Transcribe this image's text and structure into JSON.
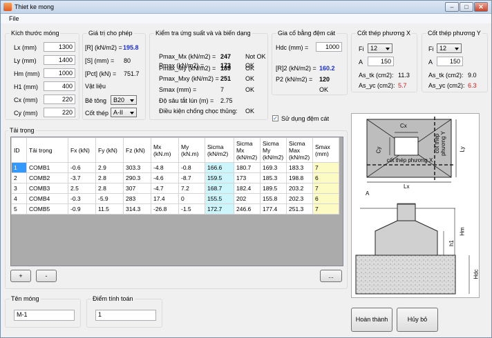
{
  "window": {
    "title": "Thiet ke mong",
    "min": "–",
    "max": "□",
    "close": "✕"
  },
  "menu": {
    "file": "File"
  },
  "dims": {
    "title": "Kích thước móng",
    "rows": [
      {
        "label": "Lx (mm)",
        "value": "1300"
      },
      {
        "label": "Ly (mm)",
        "value": "1400"
      },
      {
        "label": "Hm (mm)",
        "value": "1000"
      },
      {
        "label": "H1 (mm)",
        "value": "400"
      },
      {
        "label": "Cx (mm)",
        "value": "220"
      },
      {
        "label": "Cy (mm)",
        "value": "220"
      }
    ]
  },
  "allow": {
    "title": "Giá trị cho phép",
    "r_label": "[R] (kN/m2) =",
    "r_value": "195.8",
    "s_label": "[S] (mm) =",
    "s_value": "80",
    "pct_label": "[Pct] (kN) =",
    "pct_value": "751.7",
    "mat_title": "Vật liệu",
    "concrete_label": "Bê tông",
    "concrete_value": "B20",
    "steel_label": "Cốt thép",
    "steel_value": "A-II"
  },
  "check": {
    "title": "Kiểm tra ứng suất và và biến dạng",
    "rows": [
      {
        "label": "Pmax (kN/m2) =",
        "value": "173",
        "status": "OK"
      },
      {
        "label": "Pmax_Mx (kN/m2) =",
        "value": "247",
        "status": "Not OK"
      },
      {
        "label": "Pmax_My (kN/m2) =",
        "value": "189",
        "status": "OK"
      },
      {
        "label": "Pmax_Mxy (kN/m2) =",
        "value": "251",
        "status": "OK"
      },
      {
        "label": "Smax (mm) =",
        "value": "7",
        "status": "OK"
      },
      {
        "label": "Độ sâu tắt lún (m) =",
        "value": "2.75",
        "status": ""
      }
    ],
    "punch_label": "Điều kiện chống chọc thủng:",
    "punch_status": "OK"
  },
  "sand": {
    "title": "Gia cố bằng đệm cát",
    "hdc_label": "Hdc (mm) =",
    "hdc_value": "1000",
    "r2_label": "[R]2 (kN/m2) =",
    "r2_value": "160.2",
    "p2_label": "P2 (kN/m2) =",
    "p2_value": "120",
    "p2_status": "OK",
    "use_label": "Sử dụng đệm cát",
    "use_check": "✓"
  },
  "steel_x": {
    "title": "Cốt thép phương X",
    "fi_label": "Fi",
    "fi_value": "12",
    "a_label": "A",
    "a_value": "150",
    "astk_label": "As_tk (cm2):",
    "astk_value": "11.3",
    "asyc_label": "As_yc (cm2):",
    "asyc_value": "5.7"
  },
  "steel_y": {
    "title": "Cốt thép phương Y",
    "fi_label": "Fi",
    "fi_value": "12",
    "a_label": "A",
    "a_value": "150",
    "astk_label": "As_tk (cm2):",
    "astk_value": "9.0",
    "asyc_label": "As_yc (cm2):",
    "asyc_value": "6.3"
  },
  "loads": {
    "title": "Tải trọng",
    "headers": [
      "ID",
      "Tải trọng",
      "Fx (kN)",
      "Fy (kN)",
      "Fz (kN)",
      "Mx (kN.m)",
      "My (kN.m)",
      "Sicma (kN/m2)",
      "Sicma Mx (kN/m2)",
      "Sicma My (kN/m2)",
      "Sicma Max (kN/m2)",
      "Smax (mm)"
    ],
    "rows": [
      [
        "1",
        "COMB1",
        "-0.6",
        "2.9",
        "303.3",
        "-4.8",
        "-0.8",
        "166.6",
        "180.7",
        "169.3",
        "183.3",
        "7"
      ],
      [
        "2",
        "COMB2",
        "-3.7",
        "2.8",
        "290.3",
        "-4.6",
        "-8.7",
        "159.5",
        "173",
        "185.3",
        "198.8",
        "6"
      ],
      [
        "3",
        "COMB3",
        "2.5",
        "2.8",
        "307",
        "-4.7",
        "7.2",
        "168.7",
        "182.4",
        "189.5",
        "203.2",
        "7"
      ],
      [
        "4",
        "COMB4",
        "-0.3",
        "-5.9",
        "283",
        "17.4",
        "0",
        "155.5",
        "202",
        "155.8",
        "202.3",
        "6"
      ],
      [
        "5",
        "COMB5",
        "-0.9",
        "11.5",
        "314.3",
        "-26.8",
        "-1.5",
        "172.7",
        "246.6",
        "177.4",
        "251.3",
        "7"
      ]
    ],
    "add": "+",
    "remove": "-",
    "more": "..."
  },
  "name": {
    "title": "Tên móng",
    "value": "M-1"
  },
  "point": {
    "title": "Điểm tính toán",
    "value": "1"
  },
  "diagram": {
    "cx": "Cx",
    "cy": "Cy",
    "lx": "Lx",
    "ly": "Ly",
    "steel_x": "cốt thép phương X",
    "steel_y": "cốt thép phương Y",
    "a": "A",
    "hm": "Hm",
    "h1": "h1",
    "hdc": "Hdc"
  },
  "buttons": {
    "finish": "Hoàn thành",
    "cancel": "Hủy bỏ"
  }
}
